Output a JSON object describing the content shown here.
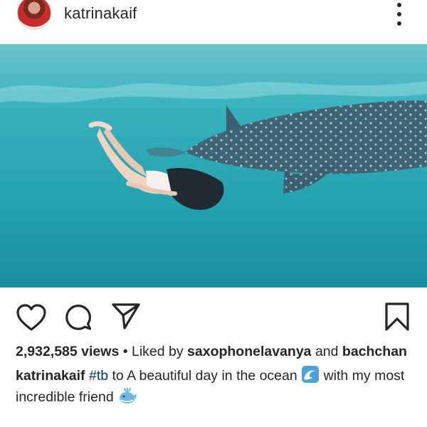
{
  "post": {
    "username": "katrinakaif",
    "views": "2,932,585 views",
    "separator": "•",
    "liked_prefix": "Liked by",
    "liked_user": "saxophonelavanya",
    "and_text": "and",
    "liked_other": "bachchan",
    "caption_user": "katrinakaif",
    "hashtag": "#tb",
    "caption_part1": "to A beautiful day in the ocean",
    "caption_part2": "with",
    "caption_part3": "my most incredible friend"
  },
  "icons": {
    "avatar": "profile-photo",
    "more": "more-options-icon",
    "like": "heart-icon",
    "comment": "comment-icon",
    "share": "send-icon",
    "save": "bookmark-icon",
    "emoji_wave": "water-wave-emoji",
    "emoji_whale": "spouting-whale-emoji"
  },
  "colors": {
    "ocean_light": "#3fb6bd",
    "ocean_dark": "#1b8a9c",
    "hashtag": "#00376b",
    "text": "#262626"
  }
}
